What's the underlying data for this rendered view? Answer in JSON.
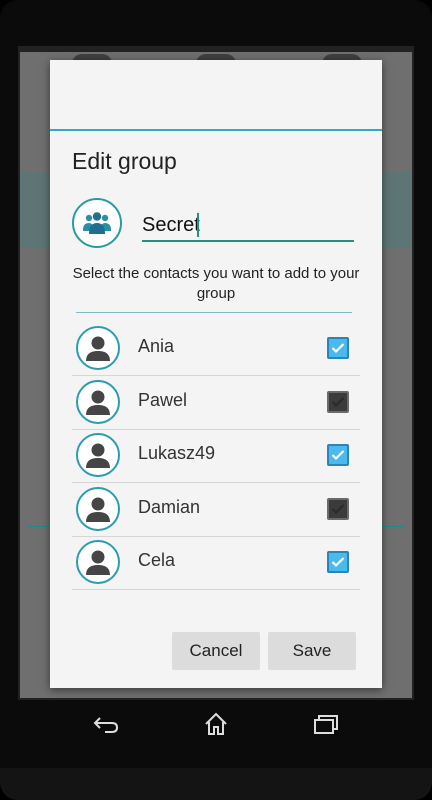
{
  "dialog": {
    "title": "Edit group",
    "group_name": "Secret",
    "prompt": "Select the contacts you want to add to your group",
    "contacts": [
      {
        "name": "Ania",
        "checked": true
      },
      {
        "name": "Pawel",
        "checked": false
      },
      {
        "name": "Lukasz49",
        "checked": true
      },
      {
        "name": "Damian",
        "checked": false
      },
      {
        "name": "Cela",
        "checked": true
      }
    ],
    "cancel_label": "Cancel",
    "save_label": "Save"
  },
  "icons": {
    "group": "group-icon",
    "person": "person-icon",
    "check": "check-icon",
    "back": "back-icon",
    "home": "home-icon",
    "recents": "recents-icon"
  },
  "colors": {
    "accent_teal": "#24907f",
    "checkbox_blue": "#49b9ee",
    "dialog_bg": "#f4f4f4"
  }
}
